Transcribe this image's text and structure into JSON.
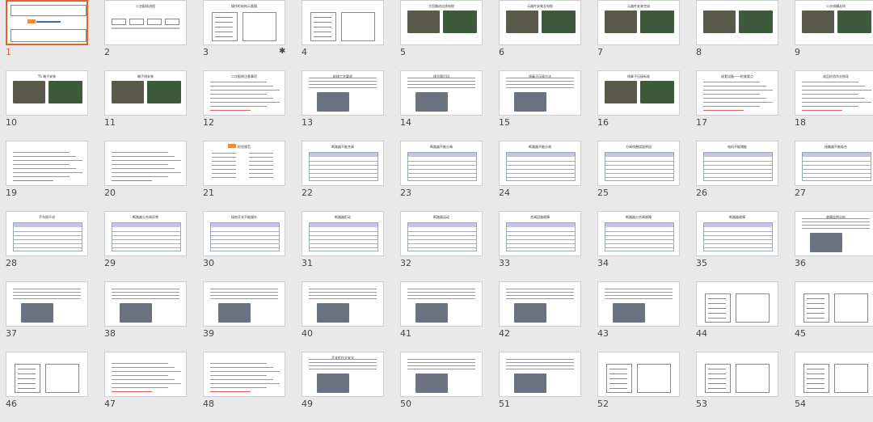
{
  "view": {
    "name": "slide-sorter",
    "selected_slide": 1
  },
  "slides": [
    {
      "n": "1",
      "kind": "title",
      "title": "",
      "selected": true
    },
    {
      "n": "2",
      "kind": "flow",
      "title": "二次配线流程"
    },
    {
      "n": "3",
      "kind": "drawing",
      "title": "操作柜结构示意图"
    },
    {
      "n": "4",
      "kind": "drawing",
      "title": ""
    },
    {
      "n": "5",
      "kind": "photos2",
      "title": "主回路进出线电缆"
    },
    {
      "n": "6",
      "kind": "photos2",
      "title": "元器件安装及电缆"
    },
    {
      "n": "7",
      "kind": "photos2",
      "title": "元器件安装完成"
    },
    {
      "n": "8",
      "kind": "photos2",
      "title": ""
    },
    {
      "n": "9",
      "kind": "photos2",
      "title": "二次线槽走线"
    },
    {
      "n": "10",
      "kind": "photos2",
      "title": "TS 端子安装"
    },
    {
      "n": "11",
      "kind": "photos2",
      "title": "端子排安装"
    },
    {
      "n": "12",
      "kind": "text",
      "title": "二次配线注意事项"
    },
    {
      "n": "13",
      "kind": "textpic",
      "title": "配线工艺要求"
    },
    {
      "n": "14",
      "kind": "textpic",
      "title": "线号管打印"
    },
    {
      "n": "15",
      "kind": "textpic",
      "title": "线鼻子压接方法"
    },
    {
      "n": "16",
      "kind": "photos2",
      "title": "线鼻子压接标准"
    },
    {
      "n": "17",
      "kind": "text",
      "title": "成套设备——检查要点"
    },
    {
      "n": "18",
      "kind": "text",
      "title": "成品检验作业指导"
    },
    {
      "n": "19",
      "kind": "text",
      "title": ""
    },
    {
      "n": "20",
      "kind": "text",
      "title": ""
    },
    {
      "n": "21",
      "kind": "list",
      "title": "检验规范"
    },
    {
      "n": "22",
      "kind": "table",
      "title": "断路器不能合闸"
    },
    {
      "n": "23",
      "kind": "table",
      "title": "断路器不能分闸"
    },
    {
      "n": "24",
      "kind": "table",
      "title": "断路器不能分闸"
    },
    {
      "n": "25",
      "kind": "table",
      "title": "分闸线圈烧毁原因"
    },
    {
      "n": "26",
      "kind": "table",
      "title": "电机不能储能"
    },
    {
      "n": "27",
      "kind": "table",
      "title": "接触器不能吸合"
    },
    {
      "n": "28",
      "kind": "table",
      "title": "手车摇不进"
    },
    {
      "n": "29",
      "kind": "table",
      "title": "断路器分合闸异常"
    },
    {
      "n": "30",
      "kind": "table",
      "title": "接地开关不能操作"
    },
    {
      "n": "31",
      "kind": "table",
      "title": "断路器拒动"
    },
    {
      "n": "32",
      "kind": "table",
      "title": "断路器误动"
    },
    {
      "n": "33",
      "kind": "table",
      "title": "合闸回路故障"
    },
    {
      "n": "34",
      "kind": "table",
      "title": "断路器分合闸故障"
    },
    {
      "n": "35",
      "kind": "table",
      "title": "断路器故障"
    },
    {
      "n": "36",
      "kind": "textpic",
      "title": "故障实例分析"
    },
    {
      "n": "37",
      "kind": "textpic",
      "title": ""
    },
    {
      "n": "38",
      "kind": "textpic",
      "title": ""
    },
    {
      "n": "39",
      "kind": "textpic",
      "title": ""
    },
    {
      "n": "40",
      "kind": "textpic",
      "title": ""
    },
    {
      "n": "41",
      "kind": "textpic",
      "title": ""
    },
    {
      "n": "42",
      "kind": "textpic",
      "title": ""
    },
    {
      "n": "43",
      "kind": "textpic",
      "title": ""
    },
    {
      "n": "44",
      "kind": "schematic",
      "title": ""
    },
    {
      "n": "45",
      "kind": "schematic",
      "title": ""
    },
    {
      "n": "46",
      "kind": "schematic",
      "title": ""
    },
    {
      "n": "47",
      "kind": "text",
      "title": ""
    },
    {
      "n": "48",
      "kind": "text",
      "title": ""
    },
    {
      "n": "49",
      "kind": "textpic",
      "title": "开关柜作业安全"
    },
    {
      "n": "50",
      "kind": "textpic",
      "title": ""
    },
    {
      "n": "51",
      "kind": "textpic",
      "title": ""
    },
    {
      "n": "52",
      "kind": "schematic",
      "title": ""
    },
    {
      "n": "53",
      "kind": "schematic",
      "title": ""
    },
    {
      "n": "54",
      "kind": "schematic",
      "title": ""
    }
  ],
  "animation_marker": {
    "slide": "3",
    "symbol": "✱"
  },
  "colors": {
    "accent": "#e8612c",
    "background": "#e9e9e9",
    "thumb": "#ffffff"
  }
}
